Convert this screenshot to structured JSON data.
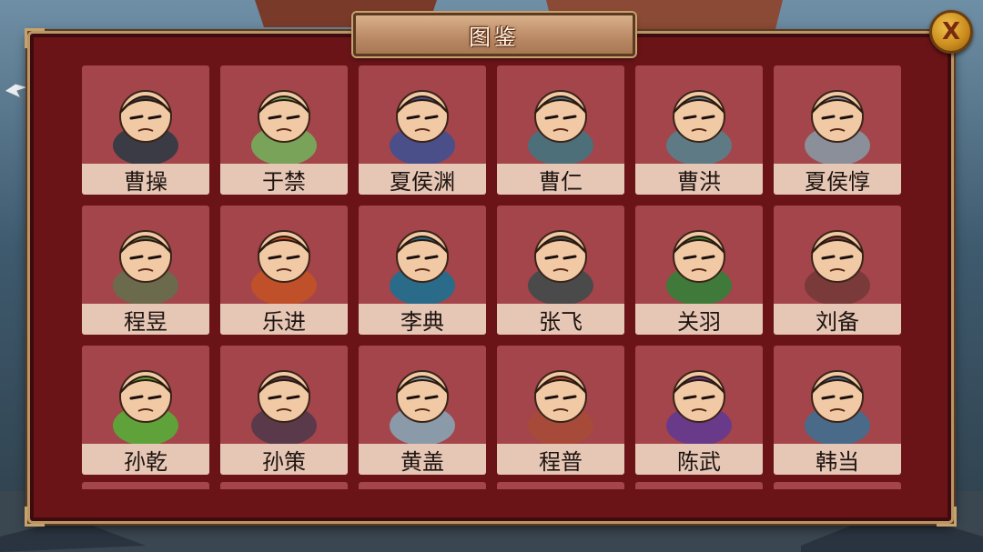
{
  "title": "图鉴",
  "close_label": "X",
  "heroes": [
    {
      "name": "曹操",
      "icon": "hero-portrait-icon",
      "color": "#3b3b45"
    },
    {
      "name": "于禁",
      "icon": "hero-portrait-icon",
      "color": "#7aa35a"
    },
    {
      "name": "夏侯渊",
      "icon": "hero-portrait-icon",
      "color": "#4a4f8a"
    },
    {
      "name": "曹仁",
      "icon": "hero-portrait-icon",
      "color": "#4c6f7a"
    },
    {
      "name": "曹洪",
      "icon": "hero-portrait-icon",
      "color": "#5e7a84"
    },
    {
      "name": "夏侯惇",
      "icon": "hero-portrait-icon",
      "color": "#8a8f99"
    },
    {
      "name": "程昱",
      "icon": "hero-portrait-icon",
      "color": "#6b6a4c"
    },
    {
      "name": "乐进",
      "icon": "hero-portrait-icon",
      "color": "#c0502a"
    },
    {
      "name": "李典",
      "icon": "hero-portrait-icon",
      "color": "#2b6b8a"
    },
    {
      "name": "张飞",
      "icon": "hero-portrait-icon",
      "color": "#4a4a4a"
    },
    {
      "name": "关羽",
      "icon": "hero-portrait-icon",
      "color": "#3f7a3a"
    },
    {
      "name": "刘备",
      "icon": "hero-portrait-icon",
      "color": "#7a3a3a"
    },
    {
      "name": "孙乾",
      "icon": "hero-portrait-icon",
      "color": "#5fa23a"
    },
    {
      "name": "孙策",
      "icon": "hero-portrait-icon",
      "color": "#5a3a4a"
    },
    {
      "name": "黄盖",
      "icon": "hero-portrait-icon",
      "color": "#8a9aa8"
    },
    {
      "name": "程普",
      "icon": "hero-portrait-icon",
      "color": "#a84a3a"
    },
    {
      "name": "陈武",
      "icon": "hero-portrait-icon",
      "color": "#6a3a8a"
    },
    {
      "name": "韩当",
      "icon": "hero-portrait-icon",
      "color": "#4a6a8a"
    }
  ],
  "colors": {
    "panel": "#6a1418",
    "card": "#a3454a",
    "name_bar": "#e6c7b6",
    "frame": "#b99667"
  }
}
